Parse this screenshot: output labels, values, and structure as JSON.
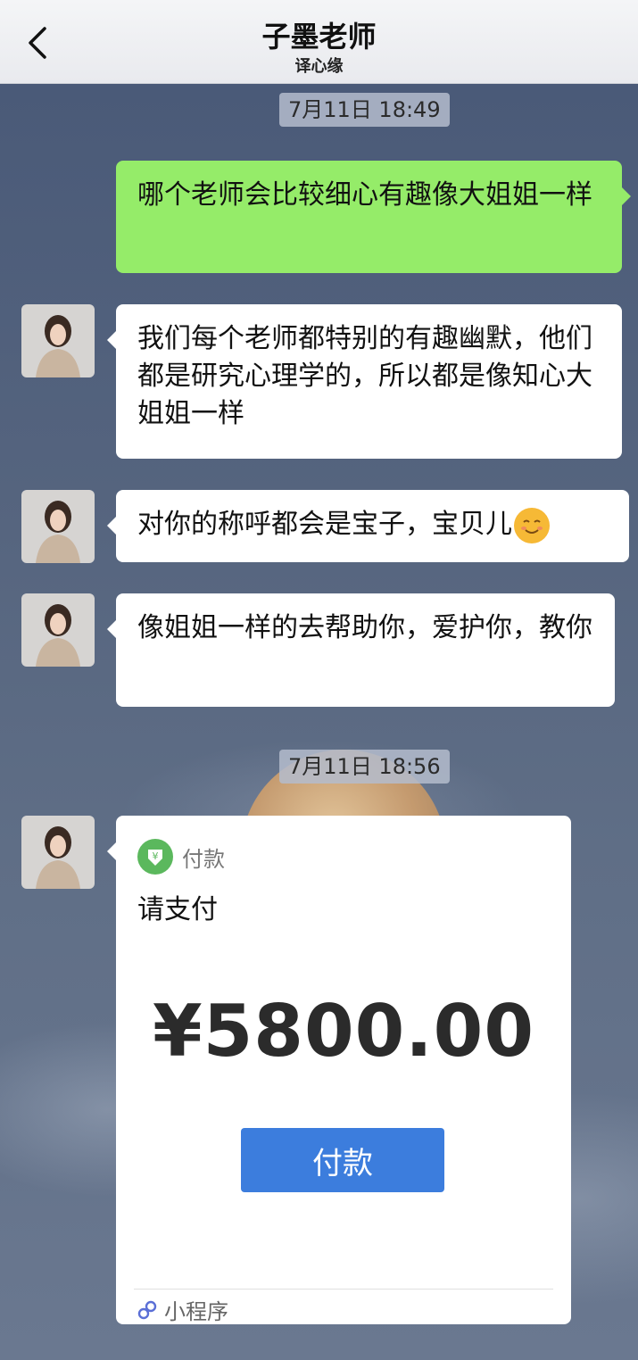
{
  "header": {
    "back_icon": "chevron-left-icon",
    "title": "子墨老师",
    "subtitle": "译心缘"
  },
  "timestamps": [
    "7月11日 18:49",
    "7月11日 18:56"
  ],
  "messages": [
    {
      "side": "right",
      "text": "哪个老师会比较细心有趣像大姐姐一样"
    },
    {
      "side": "left",
      "text": "我们每个老师都特别的有趣幽默，他们都是研究心理学的，所以都是像知心大姐姐一样"
    },
    {
      "side": "left",
      "text": "对你的称呼都会是宝子，宝贝儿",
      "emoji": "smiling-face-icon"
    },
    {
      "side": "left",
      "text": "像姐姐一样的去帮助你，爱护你，教你"
    }
  ],
  "payment_card": {
    "header_label": "付款",
    "description": "请支付",
    "amount": "¥5800.00",
    "button_label": "付款",
    "footer_label": "小程序"
  },
  "colors": {
    "header_bg": "#eceef1",
    "chat_bg": "#56657f",
    "sent_bubble": "#95ec69",
    "received_bubble": "#ffffff",
    "pay_button": "#3c7ddd",
    "pay_badge": "#5bb85d"
  }
}
